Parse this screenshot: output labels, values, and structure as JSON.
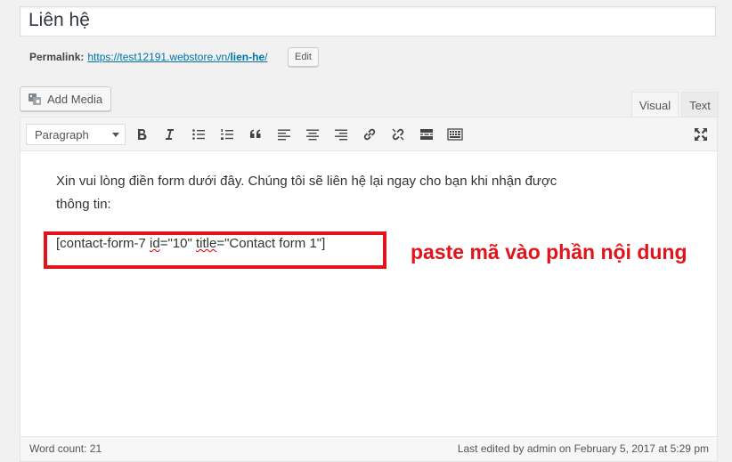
{
  "title": {
    "value": "Liên hệ"
  },
  "permalink": {
    "label": "Permalink:",
    "url_base": "https://test12191.webstore.vn/",
    "slug": "lien-he",
    "url_end": "/",
    "edit_label": "Edit"
  },
  "media": {
    "add_label": "Add Media"
  },
  "tabs": {
    "visual": "Visual",
    "text": "Text",
    "active": "Visual"
  },
  "toolbar": {
    "format_value": "Paragraph",
    "buttons": [
      "bold-icon",
      "italic-icon",
      "bullet-list-icon",
      "numbered-list-icon",
      "blockquote-icon",
      "align-left-icon",
      "align-center-icon",
      "align-right-icon",
      "link-icon",
      "unlink-icon",
      "read-more-icon",
      "toolbar-toggle-icon",
      "fullscreen-icon"
    ]
  },
  "content": {
    "paragraph": "Xin vui lòng điền form dưới đây. Chúng tôi sẽ liên hệ lại ngay cho bạn khi nhận được thông tin:",
    "shortcode_1": "[contact-form-7 ",
    "shortcode_id": "id",
    "shortcode_2": "=\"10\" ",
    "shortcode_title": "title",
    "shortcode_3": "=\"Contact form 1\"]"
  },
  "annotation": {
    "text": "paste mã vào phần nội dung",
    "color": "#e3131b"
  },
  "status": {
    "word_count": "Word count: 21",
    "last_edited": "Last edited by admin on February 5, 2017 at 5:29 pm"
  }
}
